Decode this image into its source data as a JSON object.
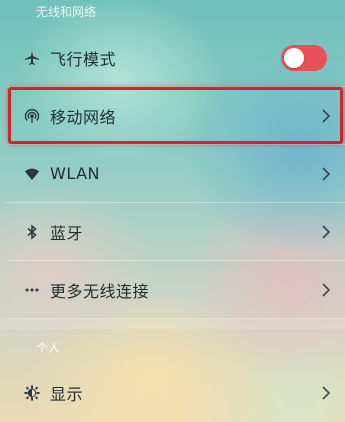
{
  "section_wireless": {
    "title": "无线和网络"
  },
  "section_personal": {
    "title": "个人"
  },
  "items": [
    {
      "label": "飞行模式",
      "icon": "airplane-icon",
      "toggle": "on"
    },
    {
      "label": "移动网络",
      "icon": "cellular-signal-icon",
      "highlighted": true
    },
    {
      "label": "WLAN",
      "icon": "wifi-icon"
    },
    {
      "label": "蓝牙",
      "icon": "bluetooth-icon"
    },
    {
      "label": "更多无线连接",
      "icon": "more-dots-icon"
    },
    {
      "label": "显示",
      "icon": "display-brightness-icon"
    }
  ],
  "colors": {
    "highlight": "#d0262b",
    "toggle_on": "#e8515a"
  }
}
